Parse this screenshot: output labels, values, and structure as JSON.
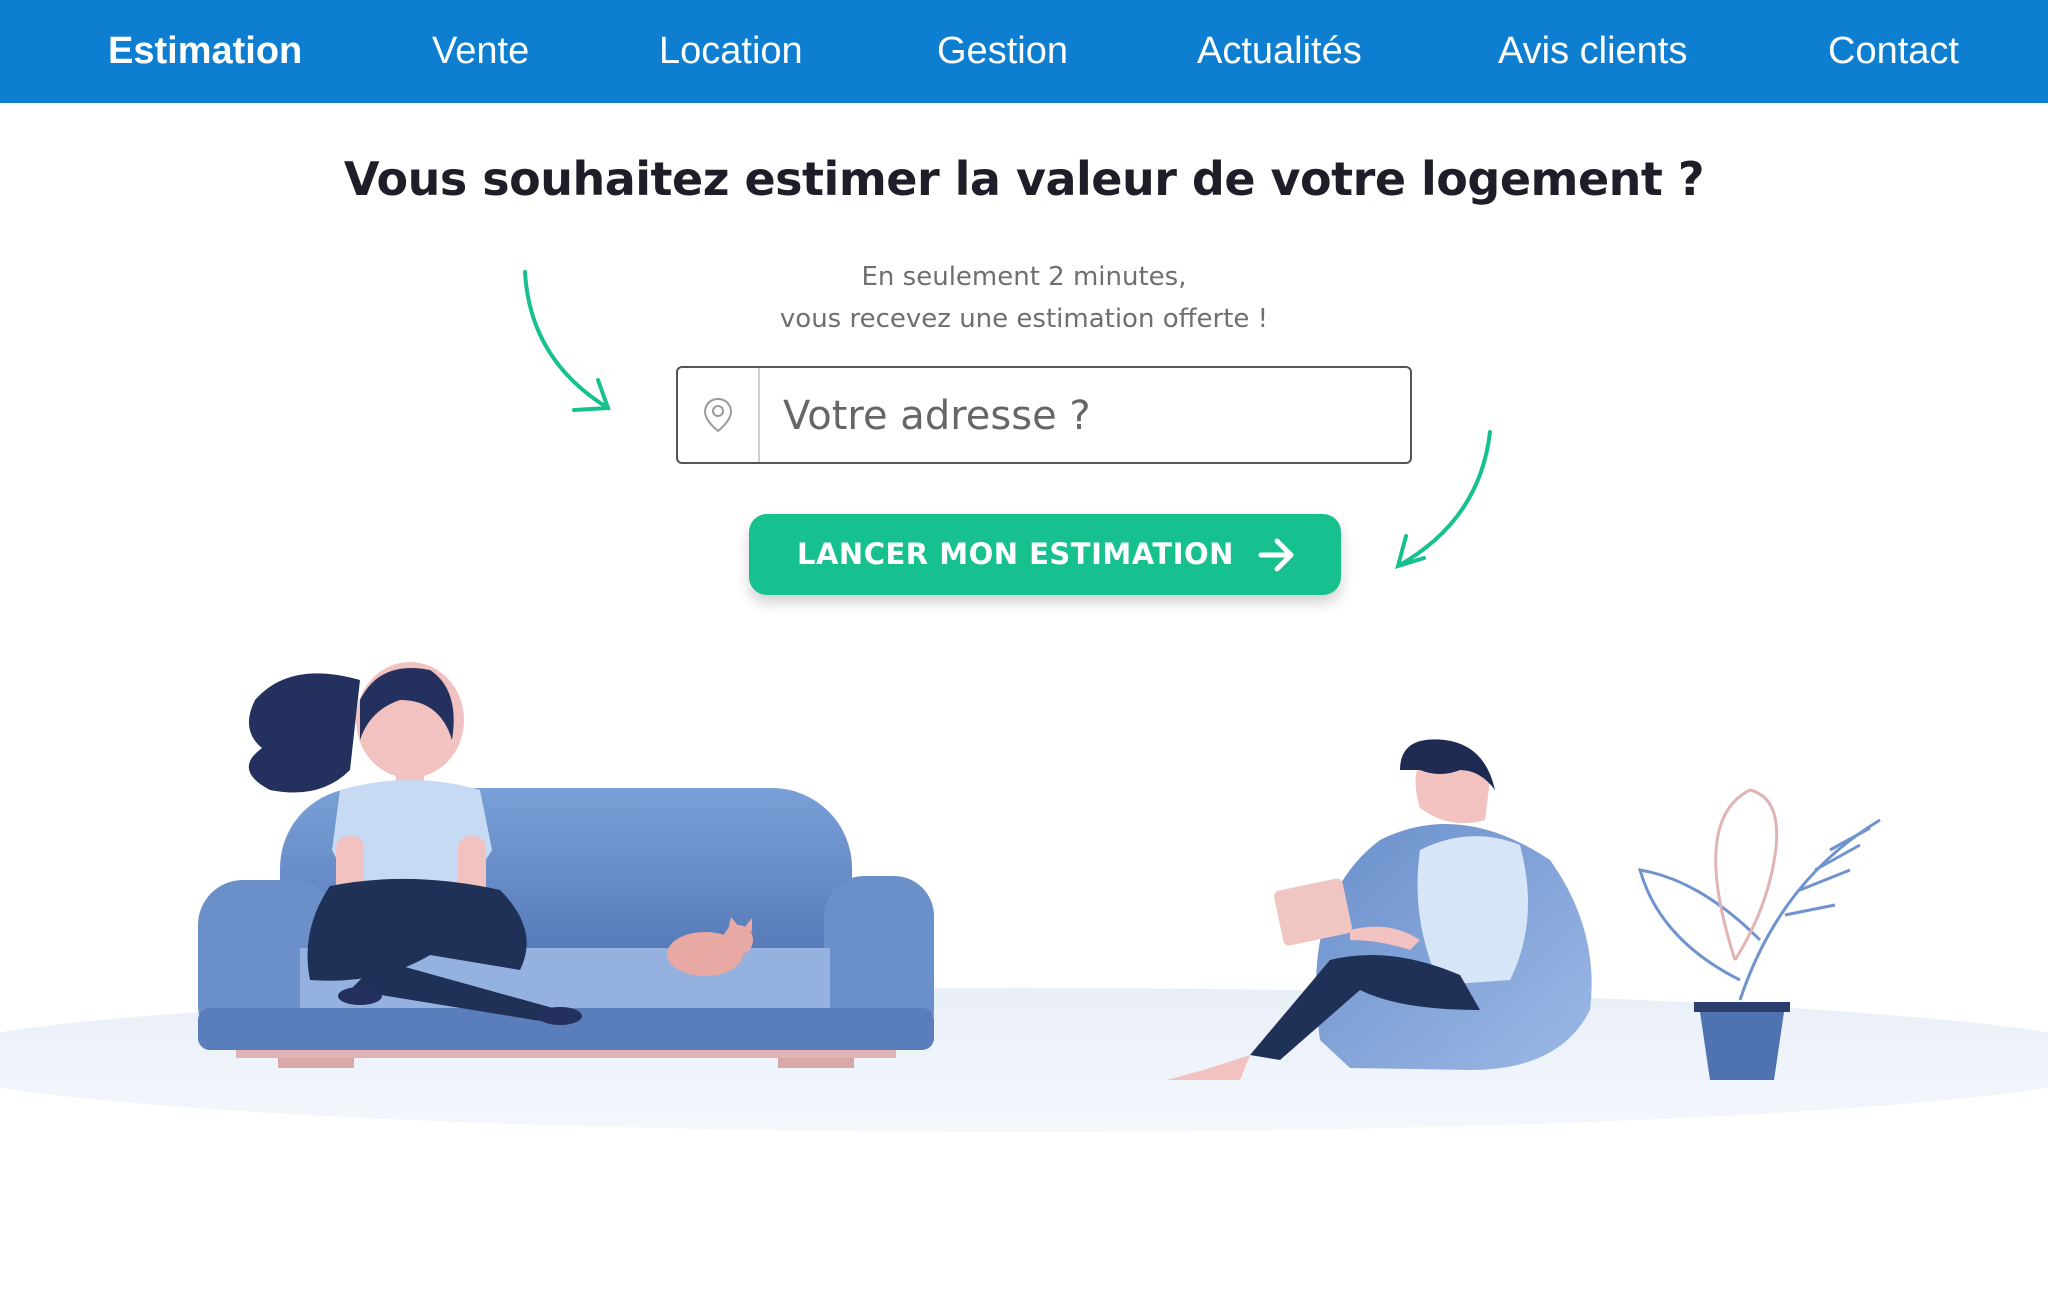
{
  "nav": {
    "items": [
      {
        "label": "Estimation",
        "active": true
      },
      {
        "label": "Vente",
        "active": false
      },
      {
        "label": "Location",
        "active": false
      },
      {
        "label": "Gestion",
        "active": false
      },
      {
        "label": "Actualités",
        "active": false
      },
      {
        "label": "Avis clients",
        "active": false
      },
      {
        "label": "Contact",
        "active": false
      }
    ]
  },
  "hero": {
    "title": "Vous souhaitez estimer la valeur de votre logement ?",
    "subtitle_line1": "En seulement 2 minutes,",
    "subtitle_line2": "vous recevez une estimation offerte !",
    "search": {
      "value": "",
      "placeholder": "Votre adresse ?",
      "icon": "location-pin-icon"
    },
    "cta": {
      "label": "LANCER MON ESTIMATION",
      "icon": "arrow-right-icon"
    }
  },
  "colors": {
    "nav_bg": "#0d7ed0",
    "accent": "#17c08f",
    "title": "#1e1e28",
    "subtitle": "#6f6f6f"
  }
}
